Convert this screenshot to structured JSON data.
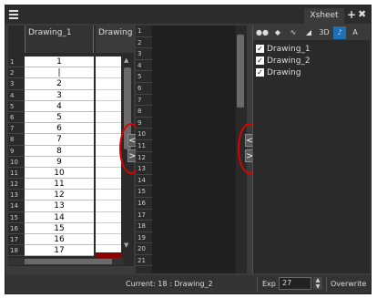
{
  "window": {
    "tab_title": "Xsheet",
    "add_glyph": "+",
    "close_glyph": "✖"
  },
  "left_panel": {
    "columns": [
      "Drawing_1",
      "Drawing"
    ],
    "row_numbers": [
      "1",
      "2",
      "3",
      "4",
      "5",
      "6",
      "7",
      "8",
      "9",
      "10",
      "11",
      "12",
      "13",
      "14",
      "15",
      "16",
      "17",
      "18"
    ],
    "col1_cells": [
      "1",
      "|",
      "2",
      "3",
      "4",
      "5",
      "6",
      "7",
      "8",
      "9",
      "10",
      "11",
      "12",
      "13",
      "14",
      "15",
      "16",
      "17"
    ]
  },
  "middle_panel": {
    "row_numbers": [
      "1",
      "2",
      "3",
      "4",
      "5",
      "6",
      "7",
      "8",
      "9",
      "10",
      "11",
      "12",
      "13",
      "14",
      "15",
      "16",
      "17",
      "18",
      "19",
      "20",
      "21"
    ]
  },
  "collapse_buttons": {
    "collapse_glyph": "<",
    "expand_glyph": ">"
  },
  "right_panel": {
    "toolbar": [
      {
        "name": "onion-skin-icon",
        "glyph": "●●"
      },
      {
        "name": "color-icon",
        "glyph": "◆"
      },
      {
        "name": "function-curve-icon",
        "glyph": "∿"
      },
      {
        "name": "keyframe-icon",
        "glyph": "◢"
      },
      {
        "name": "3d-label",
        "glyph": "3D"
      },
      {
        "name": "sound-icon",
        "glyph": "♪"
      },
      {
        "name": "annotation-icon",
        "glyph": "A"
      }
    ],
    "layers": [
      {
        "label": "Drawing_1",
        "checked": true
      },
      {
        "label": "Drawing_2",
        "checked": true
      },
      {
        "label": "Drawing",
        "checked": true
      }
    ]
  },
  "status_bar": {
    "current": "Current: 18 : Drawing_2",
    "exp_label": "Exp",
    "exp_value": "27",
    "mode": "Overwrite"
  },
  "colors": {
    "highlight": "#e00000",
    "selected_tool": "#1f6fb5"
  }
}
